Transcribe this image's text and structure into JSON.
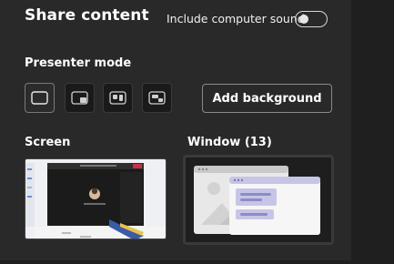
{
  "header": {
    "title": "Share content",
    "sound_label": "Include computer sound",
    "sound_enabled": false
  },
  "presenter": {
    "label": "Presenter mode",
    "modes": [
      {
        "icon": "content-only-icon",
        "selected": true
      },
      {
        "icon": "standout-icon",
        "selected": false
      },
      {
        "icon": "side-by-side-icon",
        "selected": false
      },
      {
        "icon": "reporter-icon",
        "selected": false
      }
    ],
    "add_background_label": "Add background"
  },
  "sources": {
    "screen_label": "Screen",
    "window_label": "Window (13)"
  },
  "colors": {
    "panel": "#292929",
    "accent": "#8b8cc7",
    "window_illustration_header": "#c7c5e6"
  }
}
